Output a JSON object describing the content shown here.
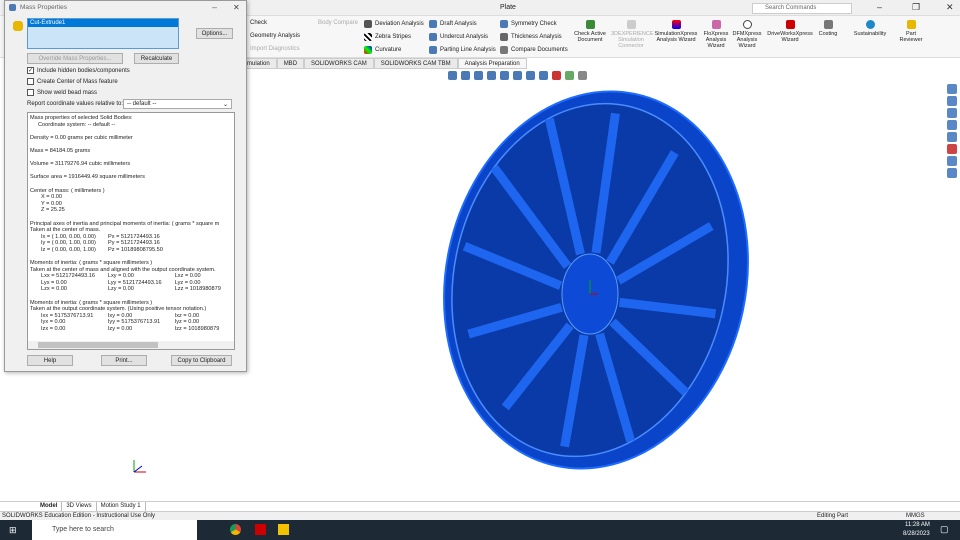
{
  "app": {
    "document_title": "Plate",
    "search_placeholder": "Search Commands"
  },
  "ribbon": {
    "col1": [
      "Check",
      "Geometry Analysis",
      "Import Diagnostics"
    ],
    "body_compare": "Body Compare",
    "col2": [
      "Deviation Analysis",
      "Zebra Stripes",
      "Curvature"
    ],
    "col3": [
      "Draft Analysis",
      "Undercut Analysis",
      "Parting Line Analysis"
    ],
    "col4": [
      "Symmetry Check",
      "Thickness Analysis",
      "Compare Documents"
    ],
    "big": [
      "Check Active Document",
      "3DEXPERIENCE Simulation Connector",
      "SimulationXpress Analysis Wizard",
      "FloXpress Analysis Wizard",
      "DFMXpress Analysis Wizard",
      "DriveWorksXpress Wizard",
      "Costing",
      "Sustainability",
      "Part Reviewer"
    ]
  },
  "tabs": [
    "mulation",
    "MBD",
    "SOLIDWORKS CAM",
    "SOLIDWORKS CAM TBM",
    "Analysis Preparation"
  ],
  "dialog": {
    "title": "Mass Properties",
    "selected_item": "Cut-Extrude1",
    "options": "Options...",
    "override": "Override Mass Properties...",
    "recalculate": "Recalculate",
    "include_hidden": "Include hidden bodies/components",
    "create_com": "Create Center of Mass feature",
    "show_weld": "Show weld bead mass",
    "report_label": "Report coordinate values relative to:",
    "coord_value": "-- default --",
    "help": "Help",
    "print": "Print...",
    "copy": "Copy to Clipboard",
    "results": {
      "l1": "Mass properties of selected Solid Bodies:",
      "l2": "Coordinate system: -- default --",
      "density": "Density = 0.00 grams per cubic millimeter",
      "mass": "Mass = 84184.05 grams",
      "volume": "Volume = 31179276.94 cubic millimeters",
      "area": "Surface area = 1916449.49  square millimeters",
      "com": "Center of mass: ( millimeters )",
      "x": "X = 0.00",
      "y": "Y = 0.00",
      "z": "Z = 25.25",
      "pa1": "Principal axes of inertia and principal moments of inertia: ( grams *  square m",
      "pa2": "Taken at the center of mass.",
      "ix": "Ix = ( 1.00,  0.00,  0.00)",
      "px": "Px = 5121724493.16",
      "iy": "Iy = ( 0.00,  1.00,  0.00)",
      "py": "Py = 5121724493.16",
      "iz": "Iz = ( 0.00,  0.00,  1.00)",
      "pz": "Pz = 10189808795.50",
      "m1": "Moments of inertia: ( grams *  square millimeters )",
      "m2": "Taken at the center of mass and aligned with the output coordinate system.",
      "L": [
        [
          "Lxx = 5121724493.16",
          "Lxy = 0.00",
          "Lxz = 0.00"
        ],
        [
          "Lyx = 0.00",
          "Lyy = 5121724493.16",
          "Lyz = 0.00"
        ],
        [
          "Lzx = 0.00",
          "Lzy = 0.00",
          "Lzz = 1018980879"
        ]
      ],
      "n1": "Moments of inertia: ( grams *  square millimeters )",
      "n2": "Taken at the output coordinate system. (Using positive tensor notation.)",
      "I": [
        [
          "Ixx = 5175376713.91",
          "Ixy = 0.00",
          "Ixz = 0.00"
        ],
        [
          "Iyx = 0.00",
          "Iyy = 5175376713.91",
          "Iyz = 0.00"
        ],
        [
          "Izx = 0.00",
          "Izy = 0.00",
          "Izz = 1018980879"
        ]
      ]
    }
  },
  "bottom_tabs": [
    "Model",
    "3D Views",
    "Motion Study 1"
  ],
  "status": {
    "left": "SOLIDWORKS Education Edition - Instructional Use Only",
    "mode": "Editing Part",
    "units": "MMGS"
  },
  "taskbar": {
    "search": "Type here to search",
    "time": "11:28 AM",
    "date": "8/28/2023"
  }
}
